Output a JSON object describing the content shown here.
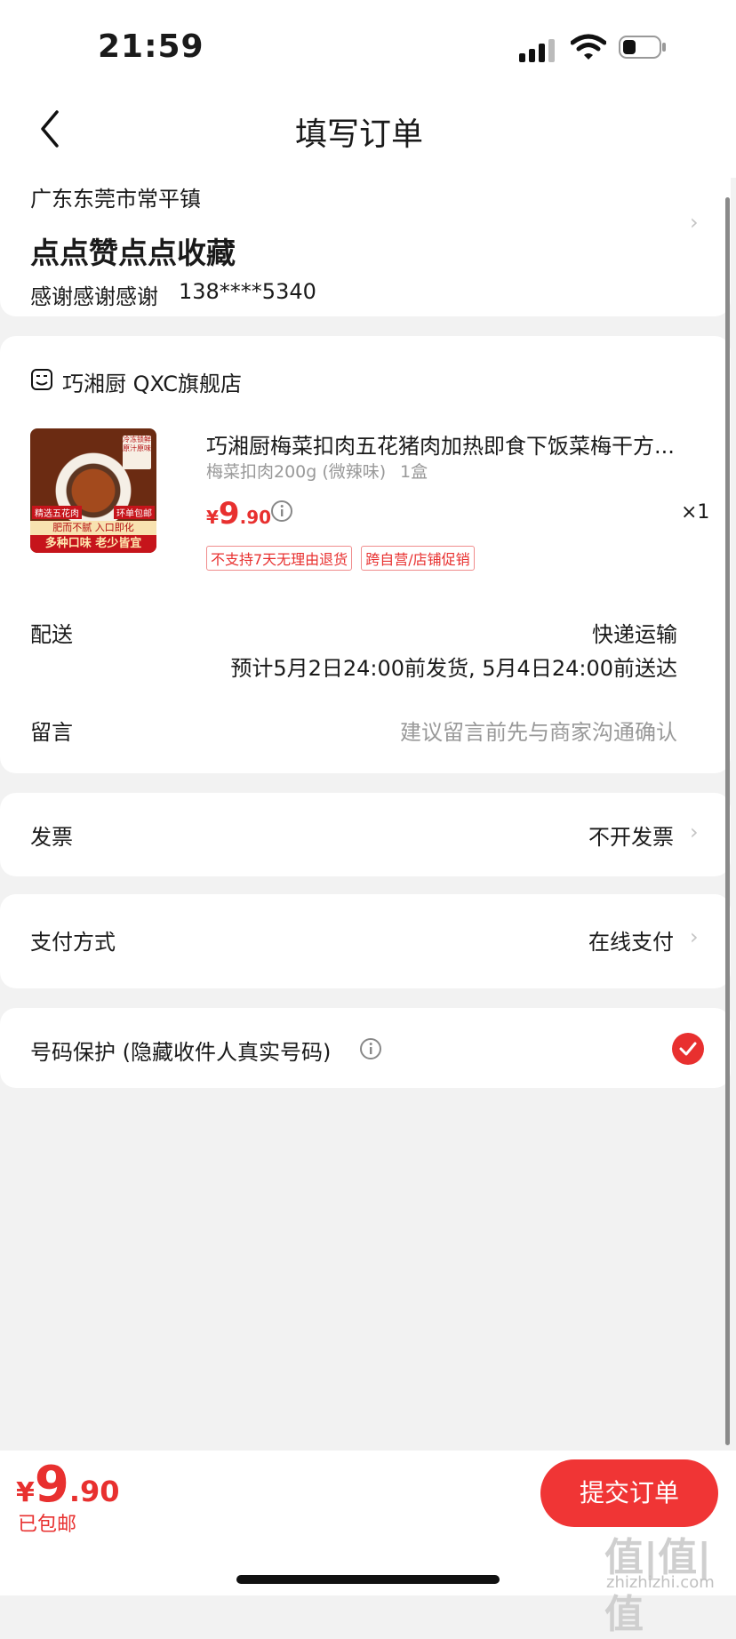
{
  "status_bar": {
    "time": "21:59"
  },
  "header": {
    "title": "填写订单"
  },
  "address": {
    "region": "广东东莞市常平镇",
    "detail": "点点赞点点收藏",
    "name": "感谢感谢感谢",
    "phone": "138****5340"
  },
  "store": {
    "name": "巧湘厨 QXC旗舰店",
    "product": {
      "title": "巧湘厨梅菜扣肉五花猪肉加热即食下饭菜梅干方...",
      "spec": "梅菜扣肉200g (微辣味)",
      "qty_unit": "1盒",
      "currency": "¥",
      "price_int": "9",
      "price_dec": ".90",
      "quantity": "×1",
      "tags": [
        "不支持7天无理由退货",
        "跨自营/店铺促销"
      ],
      "image_texts": [
        "精选五花肉",
        "肥而不腻 入口即化",
        "多种口味 老少皆宜",
        "环单包邮",
        "冷冻锁鲜 原汁原味"
      ]
    }
  },
  "delivery": {
    "label": "配送",
    "method": "快递运输",
    "eta": "预计5月2日24:00前发货, 5月4日24:00前送达"
  },
  "message": {
    "label": "留言",
    "placeholder": "建议留言前先与商家沟通确认"
  },
  "invoice": {
    "label": "发票",
    "value": "不开发票"
  },
  "payment": {
    "label": "支付方式",
    "value": "在线支付"
  },
  "number_protection": {
    "label": "号码保护 (隐藏收件人真实号码)",
    "checked": true
  },
  "bottom": {
    "currency": "¥",
    "total_int": "9",
    "total_dec": ".90",
    "shipping": "已包邮",
    "submit": "提交订单"
  },
  "watermark": {
    "main": "值|值|值",
    "sub": "zhizhizhi.com"
  },
  "colors": {
    "accent": "#e8302f",
    "background": "#f2f2f2"
  }
}
